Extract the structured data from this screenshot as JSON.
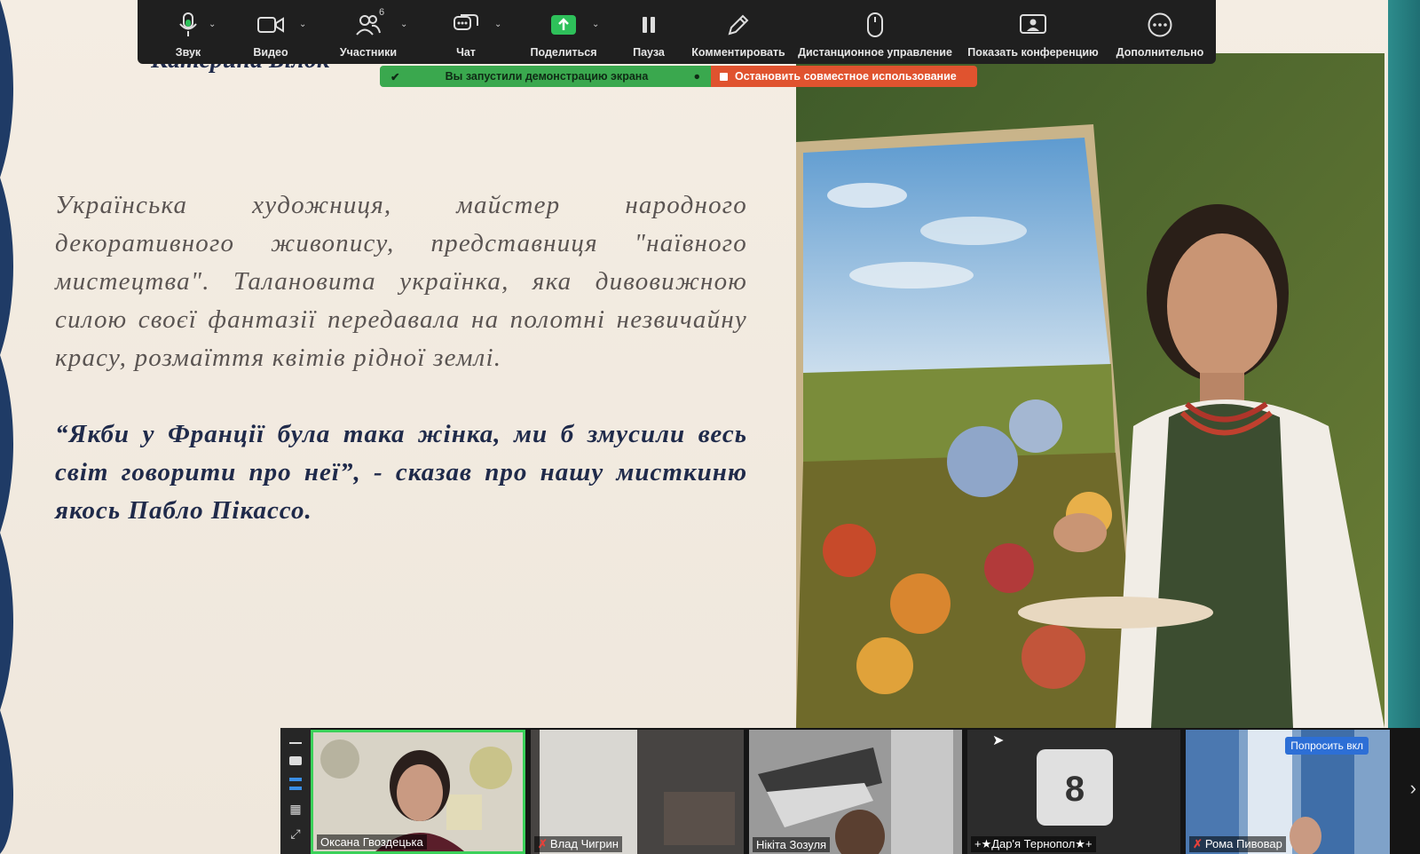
{
  "toolbar": {
    "items": [
      {
        "label": "Звук",
        "icon": "microphone-icon"
      },
      {
        "label": "Видео",
        "icon": "video-camera-icon"
      },
      {
        "label": "Участники",
        "icon": "participants-icon",
        "count": "6"
      },
      {
        "label": "Чат",
        "icon": "chat-icon"
      },
      {
        "label": "Поделиться",
        "icon": "share-screen-icon"
      },
      {
        "label": "Пауза",
        "icon": "pause-icon"
      },
      {
        "label": "Комментировать",
        "icon": "annotate-pencil-icon"
      },
      {
        "label": "Дистанционное управление",
        "icon": "mouse-icon"
      },
      {
        "label": "Показать конференцию",
        "icon": "show-meeting-icon"
      },
      {
        "label": "Дополнительно",
        "icon": "more-icon"
      }
    ],
    "colors": {
      "bg": "#1f1f1f",
      "share_green": "#2ec05a"
    }
  },
  "share_banner": {
    "status": "Вы запустили демонстрацию экрана",
    "stop": "Остановить совместное использование",
    "colors": {
      "green": "#3aa84e",
      "red": "#e0532f"
    }
  },
  "slide": {
    "title": "Катерина Білок",
    "paragraph": "Українська художниця, майстер народного декоративного живопису, представниця \"наївного мистецтва\". Талановита українка, яка дивовижною силою своєї фантазії передавала на полотні незвичайну красу, розмаїття квітів рідної землі.",
    "quote": "“Якби у Франції була така жінка, ми б змусили весь світ говорити про неї”, - сказав про нашу мисткиню якось Пабло Пікассо.",
    "colors": {
      "text": "#5a5452",
      "quote": "#1f2a4a"
    }
  },
  "video_strip": {
    "participants": [
      {
        "name": "Оксана Гвоздецька",
        "muted": false,
        "active": true
      },
      {
        "name": "Влад Чигрин",
        "muted": true,
        "active": false
      },
      {
        "name": "Нікіта Зозуля",
        "muted": false,
        "active": false
      },
      {
        "name": "+★Дар'я Тернопол★+",
        "muted": false,
        "active": false
      },
      {
        "name": "Рома Пивовар",
        "muted": true,
        "active": false
      }
    ],
    "ask_button": "Попросить вкл",
    "active_color": "#3bd15a"
  }
}
